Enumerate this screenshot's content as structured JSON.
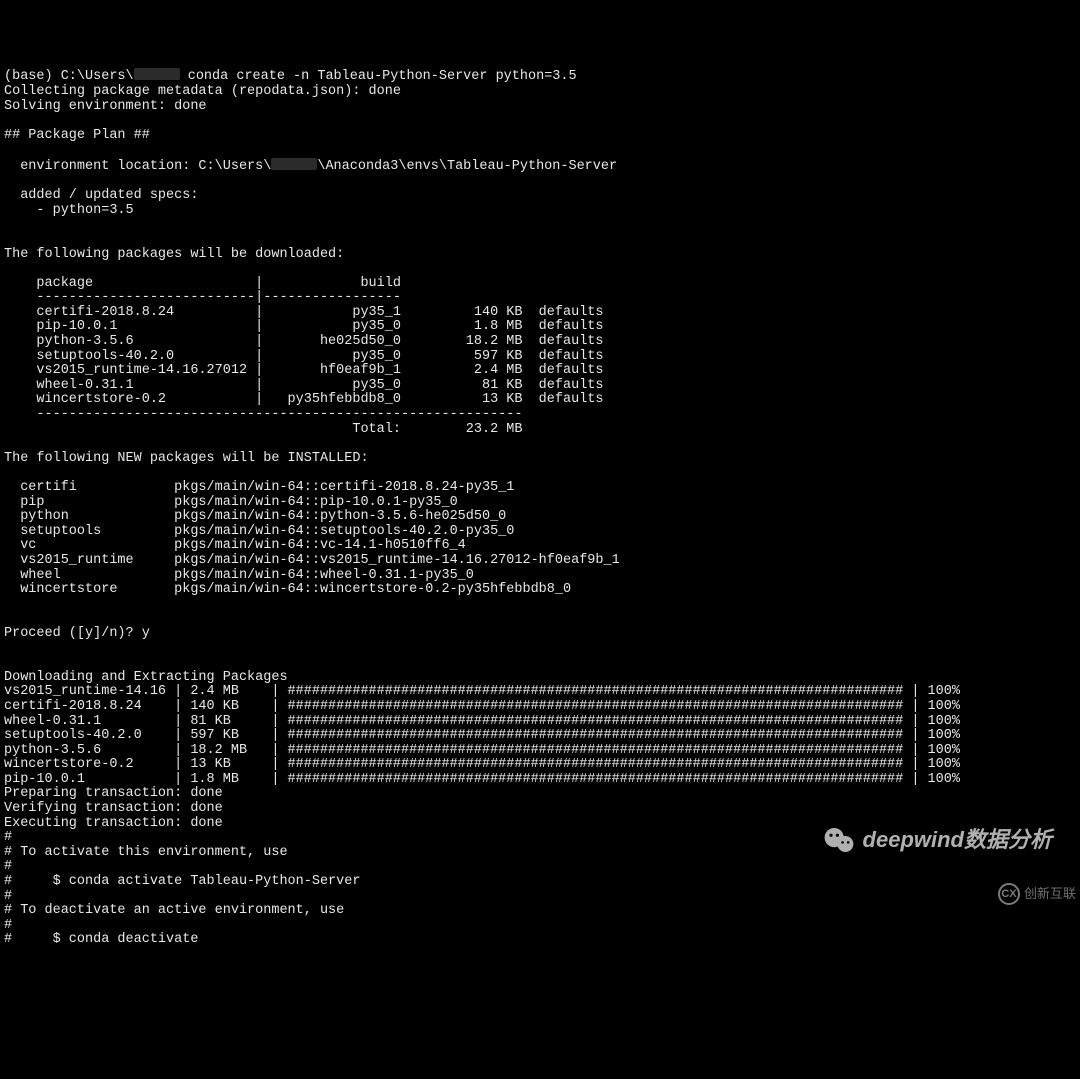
{
  "prompt": {
    "prefix": "(base) C:\\Users\\",
    "redacted": true,
    "command": "conda create -n Tableau-Python-Server python=3.5"
  },
  "collecting": "Collecting package metadata (repodata.json): done",
  "solving": "Solving environment: done",
  "plan_header": "## Package Plan ##",
  "env_loc": {
    "label": "  environment location: C:\\Users\\",
    "redacted": true,
    "tail": "\\Anaconda3\\envs\\Tableau-Python-Server"
  },
  "specs_header": "  added / updated specs:",
  "specs": "    - python=3.5",
  "dl_header": "The following packages will be downloaded:",
  "dl_col1": "    package                    |            build",
  "dl_sep": "    ---------------------------|-----------------",
  "dl_rows": [
    "    certifi-2018.8.24          |           py35_1         140 KB  defaults",
    "    pip-10.0.1                 |           py35_0         1.8 MB  defaults",
    "    python-3.5.6               |       he025d50_0        18.2 MB  defaults",
    "    setuptools-40.2.0          |           py35_0         597 KB  defaults",
    "    vs2015_runtime-14.16.27012 |       hf0eaf9b_1         2.4 MB  defaults",
    "    wheel-0.31.1               |           py35_0          81 KB  defaults",
    "    wincertstore-0.2           |   py35hfebbdb8_0          13 KB  defaults"
  ],
  "dl_bottom": "    ------------------------------------------------------------",
  "dl_total": "                                           Total:        23.2 MB",
  "new_header": "The following NEW packages will be INSTALLED:",
  "new_rows": [
    "  certifi            pkgs/main/win-64::certifi-2018.8.24-py35_1",
    "  pip                pkgs/main/win-64::pip-10.0.1-py35_0",
    "  python             pkgs/main/win-64::python-3.5.6-he025d50_0",
    "  setuptools         pkgs/main/win-64::setuptools-40.2.0-py35_0",
    "  vc                 pkgs/main/win-64::vc-14.1-h0510ff6_4",
    "  vs2015_runtime     pkgs/main/win-64::vs2015_runtime-14.16.27012-hf0eaf9b_1",
    "  wheel              pkgs/main/win-64::wheel-0.31.1-py35_0",
    "  wincertstore       pkgs/main/win-64::wincertstore-0.2-py35hfebbdb8_0"
  ],
  "proceed": "Proceed ([y]/n)? y",
  "extract_header": "Downloading and Extracting Packages",
  "extract_rows": [
    "vs2015_runtime-14.16 | 2.4 MB    | ############################################################################ | 100%",
    "certifi-2018.8.24    | 140 KB    | ############################################################################ | 100%",
    "wheel-0.31.1         | 81 KB     | ############################################################################ | 100%",
    "setuptools-40.2.0    | 597 KB    | ############################################################################ | 100%",
    "python-3.5.6         | 18.2 MB   | ############################################################################ | 100%",
    "wincertstore-0.2     | 13 KB     | ############################################################################ | 100%",
    "pip-10.0.1           | 1.8 MB    | ############################################################################ | 100%"
  ],
  "trans": [
    "Preparing transaction: done",
    "Verifying transaction: done",
    "Executing transaction: done"
  ],
  "hints": [
    "#",
    "# To activate this environment, use",
    "#",
    "#     $ conda activate Tableau-Python-Server",
    "#",
    "# To deactivate an active environment, use",
    "#",
    "#     $ conda deactivate"
  ],
  "watermark": {
    "wechat": "deepwind数据分析",
    "corner": "创新互联"
  }
}
